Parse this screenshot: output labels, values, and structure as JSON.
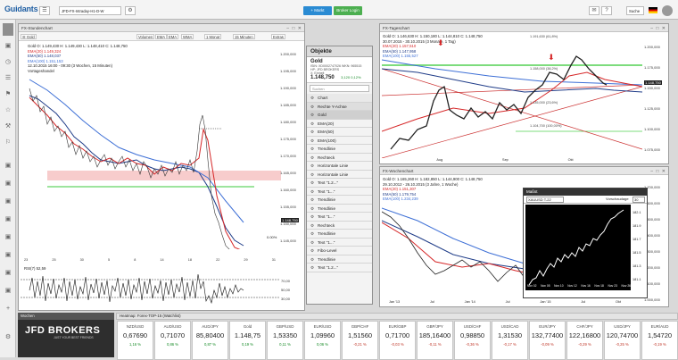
{
  "topbar": {
    "logo": "Guidants",
    "address": "JFD-FX-Intraday-H1-D-W",
    "btn_markt": "+ Markt",
    "btn_broker": "Broker Login",
    "search": "Suche"
  },
  "panel1": {
    "title": "FX-Stundenchart",
    "toolbar": [
      "Volumen",
      "EMA",
      "EMA",
      "WMA",
      "1 Monat",
      "15 Minuten",
      "Extras"
    ],
    "legend": [
      "Gold O: 1.149,430 H: 1.149,430 L: 1.148,410 C: 1.148,750",
      "EMA(20) 1.149,324",
      "EMA(50) 1.148,037",
      "EMA(100) 1.151,153",
      "12.10.2015 16:00 - 09:30 (3 Wochen, 15 Minuten)",
      "Vortageshandel"
    ],
    "yticks": [
      "1.200,000",
      "1.195,000",
      "1.190,000",
      "1.185,000",
      "1.180,000",
      "1.175,000",
      "1.170,000",
      "1.165,000",
      "1.160,000",
      "1.155,000",
      "1.150,000",
      "1.145,000",
      "1.140,000"
    ],
    "price_tag": "1.148,750",
    "pct_label": "0.00%",
    "xticks": [
      "23",
      "24",
      "25",
      "28",
      "29",
      "30",
      "1",
      "2",
      "5",
      "6",
      "7",
      "8",
      "9",
      "12",
      "14",
      "15",
      "17",
      "18",
      "20",
      "21",
      "22",
      "23",
      "28",
      "29",
      "30",
      "31"
    ],
    "rsi_title": "RSI(7) 52,59",
    "rsi_ticks": [
      "70,00",
      "50,00",
      "30,00"
    ]
  },
  "objects": {
    "title": "Objekte",
    "symbol": "Gold",
    "isin": "ISIN: XD0002747026 WKN: 965515",
    "code": "HP: JFD BROKERS",
    "exchange": "X: Einheit",
    "price": "1.148,750",
    "change": "3,120 0,12%",
    "search": "Suchen",
    "items": [
      "Chart",
      "Rechte Y-Achse",
      "Gold",
      "EMA(20)",
      "EMA(50)",
      "EMA(100)",
      "Trendlinie",
      "Rechteck",
      "Horizontale Linie",
      "Horizontale Linie",
      "Text \"1.2...\"",
      "Text \"1...\"",
      "Trendlinie",
      "Trendlinie",
      "Text \"1...\"",
      "Rechteck",
      "Trendlinie",
      "Text \"1...\"",
      "Fibo-Level",
      "Trendlinie",
      "Text \"1.2...\"",
      "Text \"1...\""
    ]
  },
  "panel2": {
    "title": "FX-Tageschart",
    "legend": [
      "Gold O: 1.146,630 H: 1.150,180 L: 1.144,810 C: 1.148,750",
      "30.07.2015 - 30.10.2015 (3 Monate, 1 Tag)",
      "EMA(20) 1.157,510",
      "EMA(50) 1.147,958",
      "EMA(100) 1.155,527"
    ],
    "yticks": [
      "1.200,000",
      "1.175,000",
      "1.150,000",
      "1.125,000",
      "1.100,000",
      "1.075,000"
    ],
    "chart_labels": [
      "1.191,630 (61,8%)",
      "1.158,000 (38,2%)",
      "1.135,000 (23,6%)",
      "1.104,700 (100,00%)"
    ],
    "price_tag": "1.148,750",
    "xticks": [
      "Aug",
      "Sep",
      "Okt"
    ]
  },
  "panel3": {
    "title": "FX-Wochenchart",
    "legend": [
      "Gold O: 1.165,260 H: 1.182,850 L: 1.144,900 C: 1.148,750",
      "29.10.2012 - 26.10.2015 (3 Jahre, 1 Woche)",
      "EMA(20) 1.151,307",
      "EMA(50) 1.179,754",
      "EMA(100) 1.234,239"
    ],
    "yticks": [
      "1.700,000",
      "1.600,000",
      "1.500,000",
      "1.400,000",
      "1.300,000",
      "1.200,000",
      "1.100,000",
      "1.000,000"
    ],
    "xticks": [
      "Jan '13",
      "Jul",
      "Jan '14",
      "Jul",
      "Jan '15",
      "Jul",
      "Okt"
    ]
  },
  "popup": {
    "title": "Maßst",
    "symbol": "XAUUSD T-22",
    "mode": "Vorschaudage",
    "count": "30",
    "ticks": [
      "182.1",
      "181.9",
      "181.7",
      "181.5",
      "181.3",
      "181.1"
    ],
    "xlabels": [
      "Nov 02",
      "Nov 05",
      "Nov 10",
      "Nov 12",
      "Nov 16",
      "Nov 18",
      "Nov 23",
      "Nov 26"
    ]
  },
  "watchlist": {
    "title": "Heatmap: Forex-TOP-15 (Watchlist)",
    "tab": "Wochen",
    "brand": "JFD BROKERS",
    "slogan": "JUST YOUR BEST FRIENDS",
    "quotes": [
      {
        "name": "NZD/USD",
        "value": "0,67690",
        "change": "1,16 %",
        "color": "#1a8c2a"
      },
      {
        "name": "AUD/USD",
        "value": "0,71070",
        "change": "0,86 %",
        "color": "#1a8c2a"
      },
      {
        "name": "AUD/JPY",
        "value": "85,80400",
        "change": "0,87 %",
        "color": "#1a8c2a"
      },
      {
        "name": "Gold",
        "value": "1.148,75",
        "change": "0,19 %",
        "color": "#1a8c2a"
      },
      {
        "name": "GBP/USD",
        "value": "1,53350",
        "change": "0,11 %",
        "color": "#1a8c2a"
      },
      {
        "name": "EUR/USD",
        "value": "1,09960",
        "change": "0,06 %",
        "color": "#1a8c2a"
      },
      {
        "name": "GBP/CHF",
        "value": "1,51560",
        "change": "-0,21 %",
        "color": "#c0392b"
      },
      {
        "name": "EUR/GBP",
        "value": "0,71700",
        "change": "-0,03 %",
        "color": "#c0392b"
      },
      {
        "name": "GBP/JPY",
        "value": "185,16400",
        "change": "-0,11 %",
        "color": "#c0392b"
      },
      {
        "name": "USD/CHF",
        "value": "0,98850",
        "change": "-0,36 %",
        "color": "#c0392b"
      },
      {
        "name": "USD/CAD",
        "value": "1,31530",
        "change": "-0,17 %",
        "color": "#c0392b"
      },
      {
        "name": "EUR/JPY",
        "value": "132,77400",
        "change": "-0,09 %",
        "color": "#c0392b"
      },
      {
        "name": "CHF/JPY",
        "value": "122,16800",
        "change": "-0,29 %",
        "color": "#c0392b"
      },
      {
        "name": "USD/JPY",
        "value": "120,74700",
        "change": "-0,25 %",
        "color": "#c0392b"
      },
      {
        "name": "EUR/AUD",
        "value": "1,54720",
        "change": "-0,19 %",
        "color": "#c0392b"
      }
    ]
  },
  "colors": {
    "ema20": "#d62728",
    "ema50": "#1f3c88",
    "ema100": "#3d6fd6",
    "accent": "#2a8bd3",
    "green_btn": "#4caf50"
  }
}
